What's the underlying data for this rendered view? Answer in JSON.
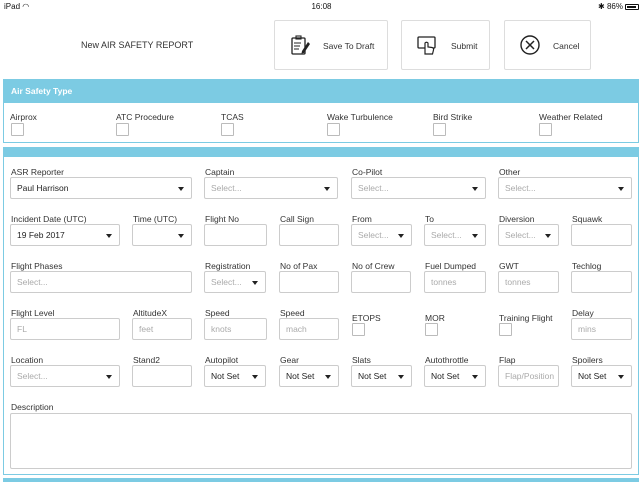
{
  "status": {
    "device": "iPad",
    "time": "16:08",
    "battery": "86%"
  },
  "header": {
    "title": "New AIR SAFETY REPORT",
    "save_draft": "Save To Draft",
    "submit": "Submit",
    "cancel": "Cancel"
  },
  "type_section": {
    "title": "Air Safety Type",
    "options": [
      "Airprox",
      "ATC Procedure",
      "TCAS",
      "Wake Turbulence",
      "Bird Strike",
      "Weather Related"
    ]
  },
  "form": {
    "row1": {
      "asr_reporter": {
        "label": "ASR Reporter",
        "value": "Paul Harrison"
      },
      "captain": {
        "label": "Captain",
        "placeholder": "Select..."
      },
      "copilot": {
        "label": "Co-Pilot",
        "placeholder": "Select..."
      },
      "other": {
        "label": "Other",
        "placeholder": "Select..."
      }
    },
    "row2": {
      "incident_date": {
        "label": "Incident Date (UTC)",
        "value": "19 Feb 2017"
      },
      "time": {
        "label": "Time (UTC)",
        "value": ""
      },
      "flight_no": {
        "label": "Flight No"
      },
      "call_sign": {
        "label": "Call Sign"
      },
      "from": {
        "label": "From",
        "placeholder": "Select..."
      },
      "to": {
        "label": "To",
        "placeholder": "Select..."
      },
      "diversion": {
        "label": "Diversion",
        "placeholder": "Select..."
      },
      "squawk": {
        "label": "Squawk"
      }
    },
    "row3": {
      "flight_phases": {
        "label": "Flight Phases",
        "placeholder": "Select..."
      },
      "registration": {
        "label": "Registration",
        "placeholder": "Select..."
      },
      "no_of_pax": {
        "label": "No of Pax"
      },
      "no_of_crew": {
        "label": "No of Crew"
      },
      "fuel_dumped": {
        "label": "Fuel Dumped",
        "placeholder": "tonnes"
      },
      "gwt": {
        "label": "GWT",
        "placeholder": "tonnes"
      },
      "techlog": {
        "label": "Techlog"
      }
    },
    "row4": {
      "flight_level": {
        "label": "Flight Level",
        "placeholder": "FL"
      },
      "altitude": {
        "label": "AltitudeX",
        "placeholder": "feet"
      },
      "speed_knots": {
        "label": "Speed",
        "placeholder": "knots"
      },
      "speed_mach": {
        "label": "Speed",
        "placeholder": "mach"
      },
      "etops": {
        "label": "ETOPS"
      },
      "mor": {
        "label": "MOR"
      },
      "training_flight": {
        "label": "Training Flight"
      },
      "delay": {
        "label": "Delay",
        "placeholder": "mins"
      }
    },
    "row5": {
      "location": {
        "label": "Location",
        "placeholder": "Select..."
      },
      "stand": {
        "label": "Stand2"
      },
      "autopilot": {
        "label": "Autopilot",
        "value": "Not Set"
      },
      "gear": {
        "label": "Gear",
        "value": "Not Set"
      },
      "slats": {
        "label": "Slats",
        "value": "Not Set"
      },
      "autothrottle": {
        "label": "Autothrottle",
        "value": "Not Set"
      },
      "flap": {
        "label": "Flap",
        "placeholder": "Flap/Position"
      },
      "spoilers": {
        "label": "Spoilers",
        "value": "Not Set"
      }
    },
    "description": {
      "label": "Description"
    }
  }
}
